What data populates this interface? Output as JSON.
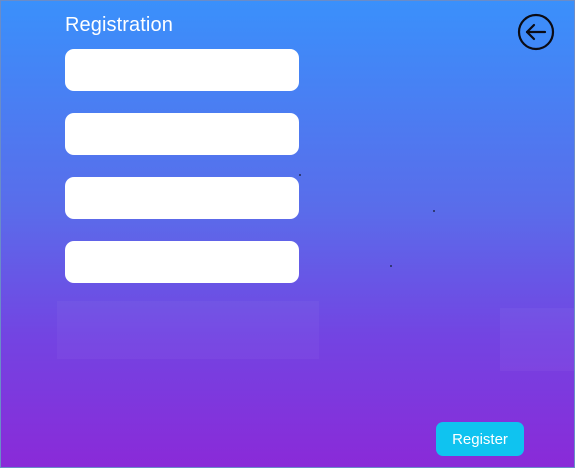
{
  "window": {
    "title": "Registration"
  },
  "header": {
    "back_icon": "arrow-left-circle-icon"
  },
  "form": {
    "fields": [
      {
        "value": "",
        "placeholder": ""
      },
      {
        "value": "",
        "placeholder": ""
      },
      {
        "value": "",
        "placeholder": ""
      },
      {
        "value": "",
        "placeholder": ""
      }
    ]
  },
  "actions": {
    "register_label": "Register"
  },
  "colors": {
    "gradient_top": "#3a90fb",
    "gradient_bottom": "#8a2ad8",
    "register_button": "#0fc3f0",
    "field_background": "#ffffff"
  }
}
